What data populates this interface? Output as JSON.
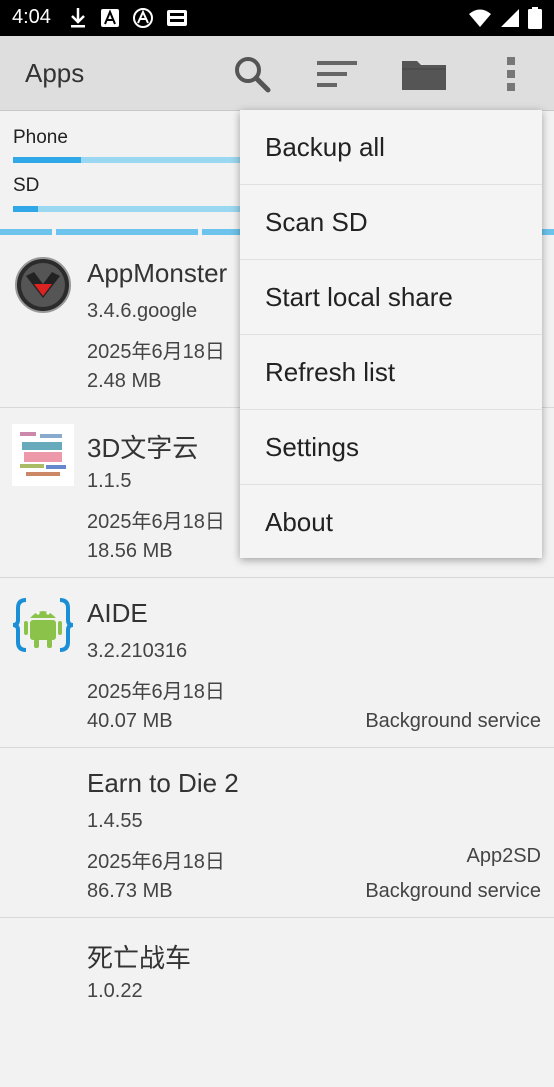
{
  "status_bar": {
    "time": "4:04",
    "left_icons": [
      "download-icon",
      "text-a-icon",
      "signal-off-icon",
      "sim-card-icon"
    ],
    "right_icons": [
      "wifi-icon",
      "cellular-icon",
      "battery-icon"
    ]
  },
  "app_bar": {
    "title": "Apps",
    "actions": [
      "search-icon",
      "sort-icon",
      "folder-icon",
      "overflow-menu-icon"
    ]
  },
  "storage": {
    "phone_label": "Phone",
    "phone_used_fraction": 0.3,
    "sd_label": "SD",
    "sd_used_fraction": 0.11
  },
  "apps": [
    {
      "name": "AppMonster",
      "version": "3.4.6.google",
      "date": "2025年6月18日",
      "size": "2.48 MB",
      "right3": "",
      "right4": ""
    },
    {
      "name": "3D文字云",
      "version": "1.1.5",
      "date": "2025年6月18日",
      "size": "18.56 MB",
      "right3": "",
      "right4": ""
    },
    {
      "name": "AIDE",
      "version": "3.2.210316",
      "date": "2025年6月18日",
      "size": "40.07 MB",
      "right3": "",
      "right4": "Background service"
    },
    {
      "name": "Earn to Die 2",
      "version": "1.4.55",
      "date": "2025年6月18日",
      "size": "86.73 MB",
      "right3": "App2SD",
      "right4": "Background service"
    },
    {
      "name": "死亡战车",
      "version": "1.0.22",
      "date": "",
      "size": "",
      "right3": "",
      "right4": ""
    }
  ],
  "menu": {
    "items": [
      "Backup all",
      "Scan SD",
      "Start local share",
      "Refresh list",
      "Settings",
      "About"
    ]
  },
  "colors": {
    "accent": "#30a8e8",
    "accent_light": "#9ad7f0",
    "app_bar": "#dedede",
    "background": "#f2f2f2"
  }
}
